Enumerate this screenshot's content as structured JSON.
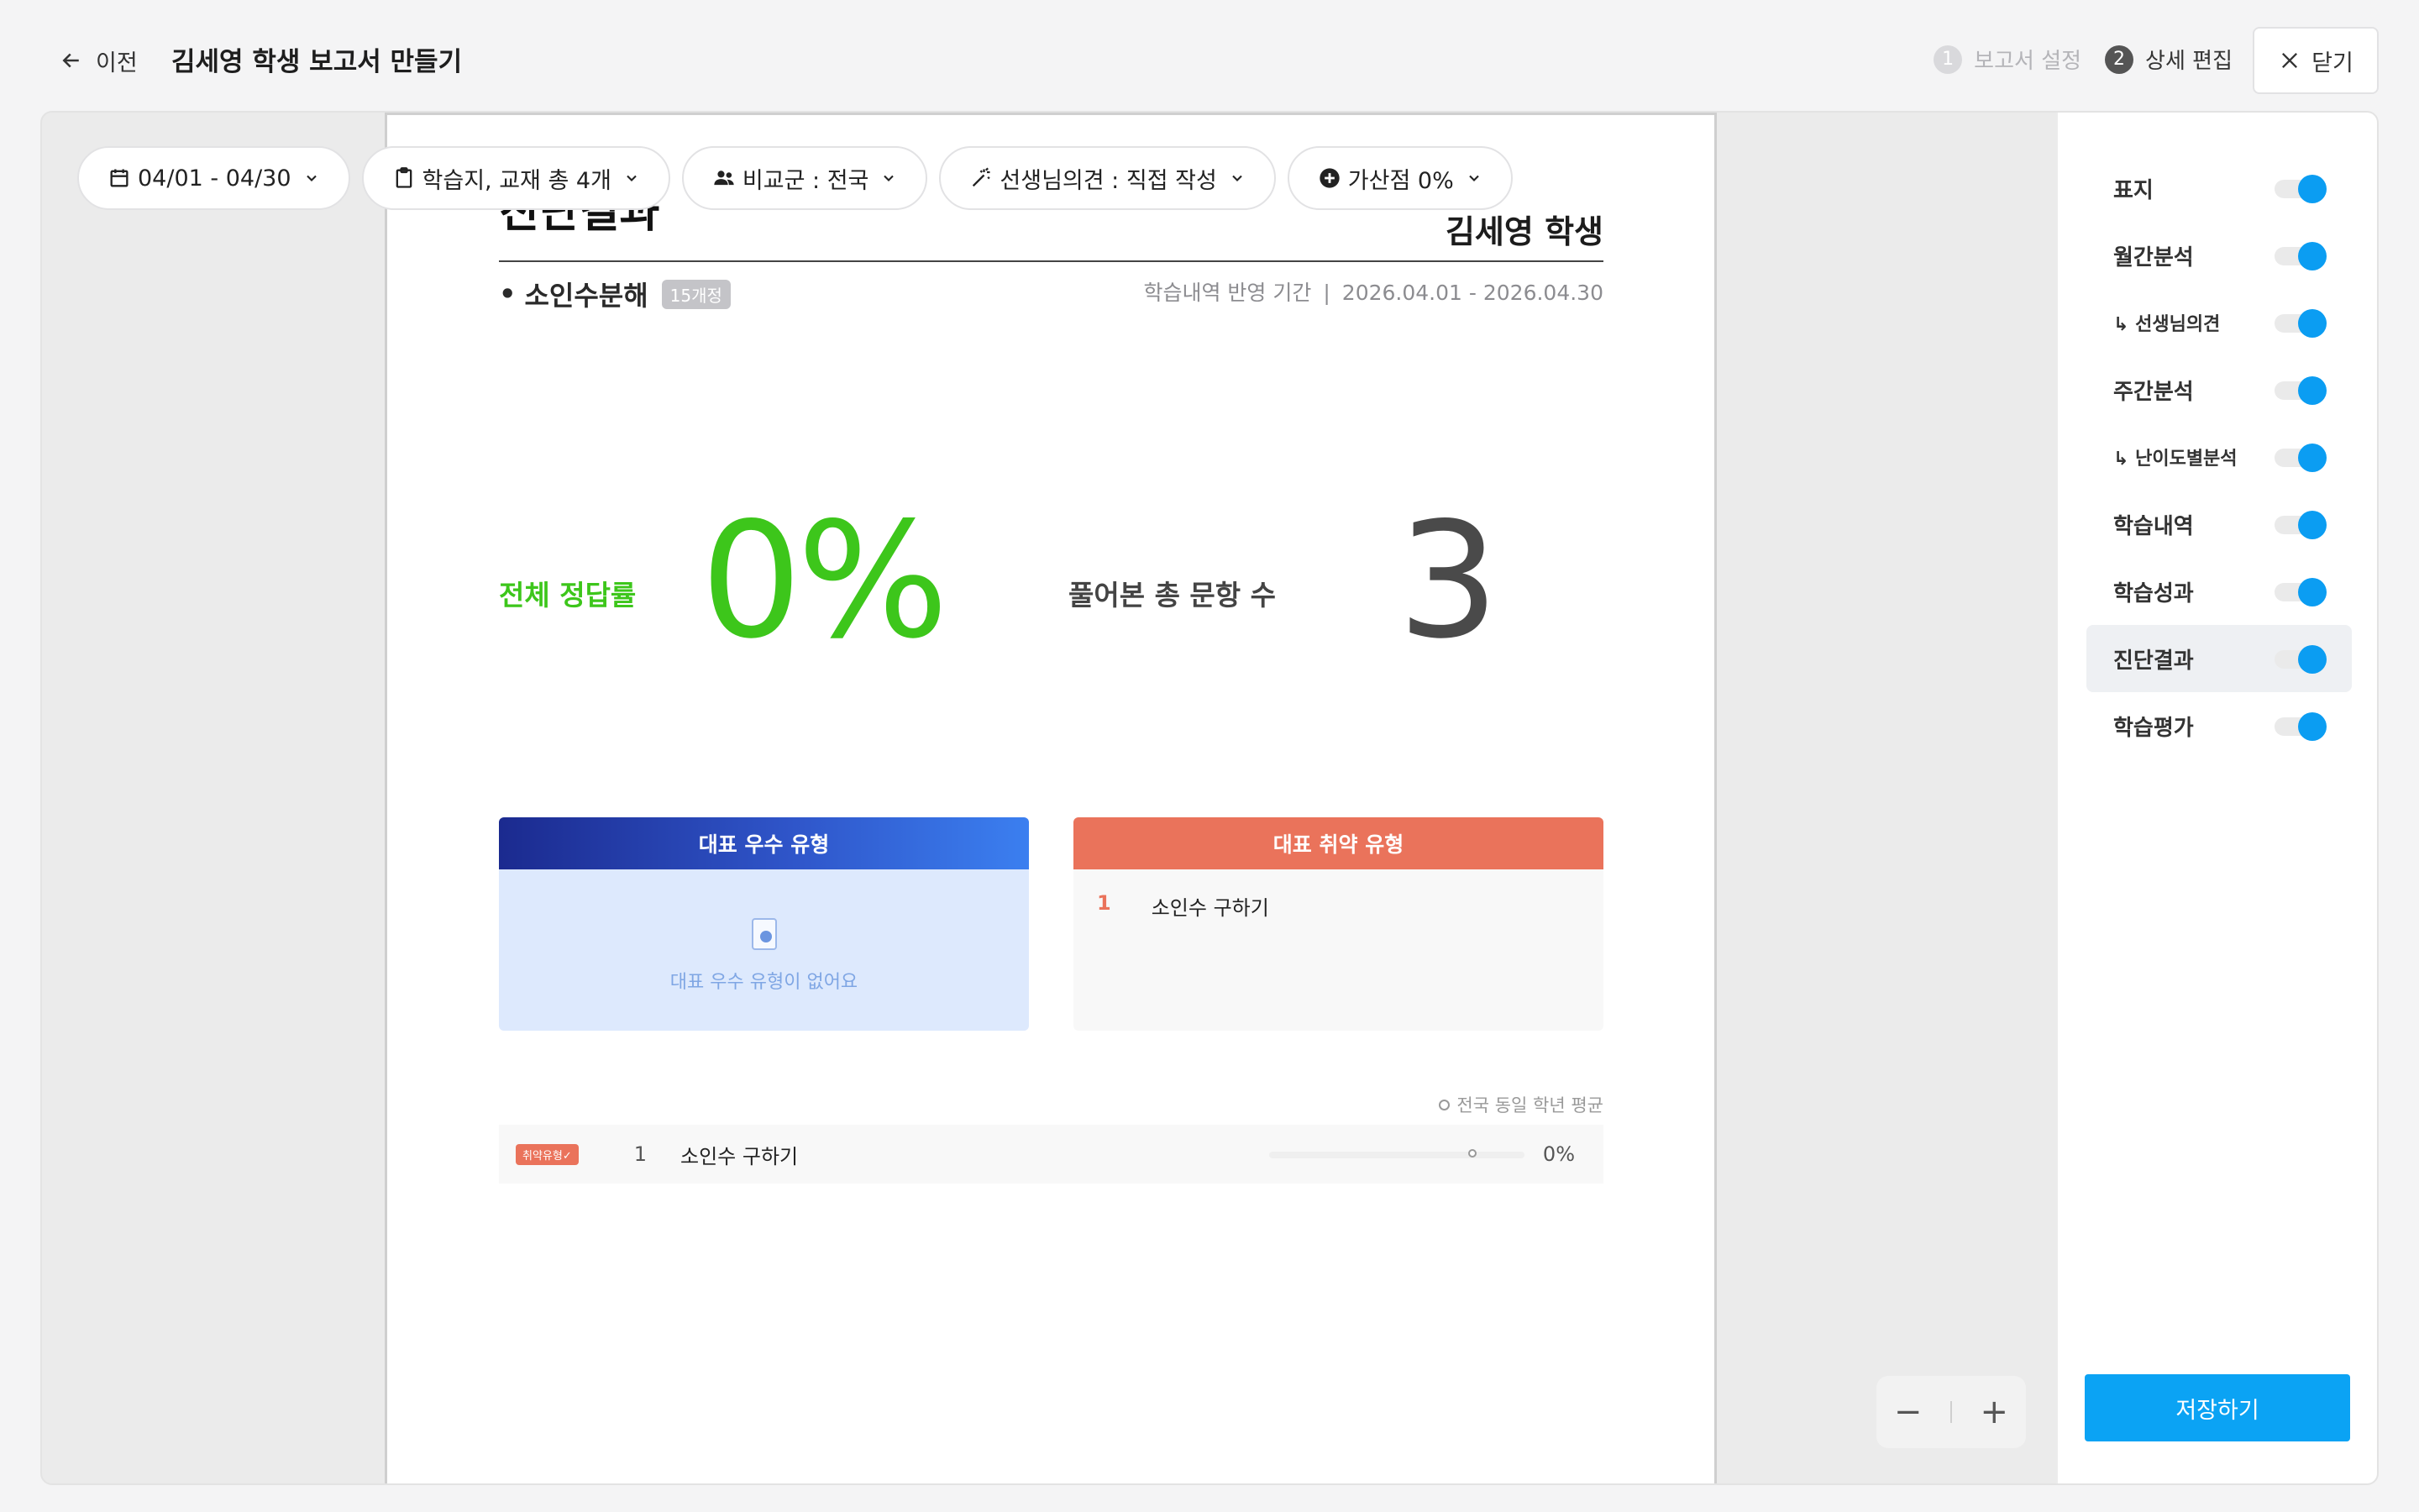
{
  "header": {
    "back_label": "이전",
    "title": "김세영 학생 보고서 만들기",
    "steps": [
      {
        "num": "1",
        "label": "보고서 설정"
      },
      {
        "num": "2",
        "label": "상세 편집"
      }
    ],
    "close_label": "닫기"
  },
  "filters": {
    "date_range": "04/01 - 04/30",
    "materials": "학습지, 교재 총 4개",
    "comparison": "비교군 : 전국",
    "teacher_opinion": "선생님의견 : 직접 작성",
    "bonus": "가산점 0%"
  },
  "report": {
    "section_heading": "진단결과",
    "student_name": "김세영 학생",
    "unit_name": "소인수분해",
    "unit_count": "15개정",
    "period_label": "학습내역 반영 기간",
    "period_separator": "|",
    "period_value": "2026.04.01 - 2026.04.30",
    "accuracy_label": "전체 정답률",
    "accuracy_value": "0%",
    "total_label": "풀어본 총 문항 수",
    "total_value": "3",
    "strong_title": "대표 우수 유형",
    "strong_empty": "대표 우수 유형이 없어요",
    "weak_title": "대표 취약 유형",
    "weak_items": [
      {
        "rank": "1",
        "name": "소인수 구하기"
      }
    ],
    "avg_legend": "전국 동일 학년 평균",
    "result_rows": [
      {
        "tag": "취약유형✓",
        "num": "1",
        "name": "소인수 구하기",
        "pct": "0%",
        "avg_fraction": 0.78
      }
    ]
  },
  "zoom": {
    "minus": "−",
    "plus": "+"
  },
  "sections": [
    {
      "label": "표지",
      "on": true,
      "sub": false,
      "selected": false
    },
    {
      "label": "월간분석",
      "on": true,
      "sub": false,
      "selected": false
    },
    {
      "label": "↳ 선생님의견",
      "on": true,
      "sub": true,
      "selected": false
    },
    {
      "label": "주간분석",
      "on": true,
      "sub": false,
      "selected": false
    },
    {
      "label": "↳ 난이도별분석",
      "on": true,
      "sub": true,
      "selected": false
    },
    {
      "label": "학습내역",
      "on": true,
      "sub": false,
      "selected": false
    },
    {
      "label": "학습성과",
      "on": true,
      "sub": false,
      "selected": false
    },
    {
      "label": "진단결과",
      "on": true,
      "sub": false,
      "selected": true
    },
    {
      "label": "학습평가",
      "on": true,
      "sub": false,
      "selected": false
    }
  ],
  "save_label": "저장하기",
  "colors": {
    "accent": "#0ba3f4",
    "correct_green": "#3dc61b",
    "weak_orange": "#ea735b",
    "strong_blue": "#2f55c9"
  }
}
